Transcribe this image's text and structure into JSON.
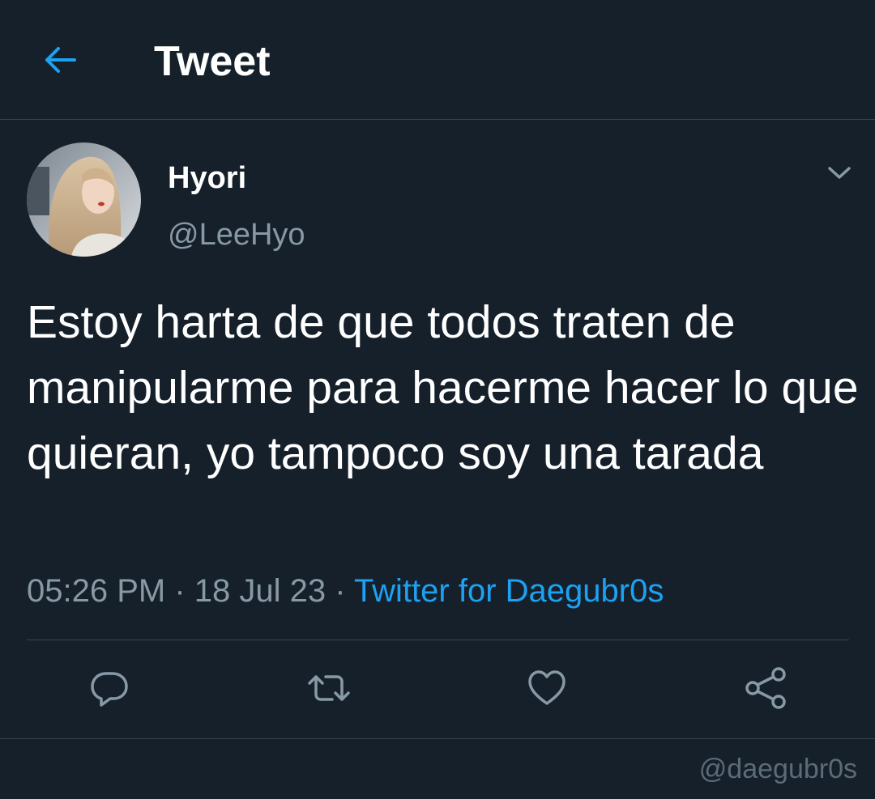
{
  "header": {
    "back_icon": "arrow-left-icon",
    "title": "Tweet"
  },
  "tweet": {
    "author": {
      "display_name": "Hyori",
      "handle": "@LeeHyo",
      "avatar": "profile photo"
    },
    "menu_icon": "chevron-down-icon",
    "text": "Estoy harta de que todos traten de manipularme para hacerme hacer lo que quieran, yo tampoco soy una tarada",
    "time": "05:26 PM",
    "separator": " · ",
    "date": "18 Jul 23",
    "source": "Twitter for Daegubr0s"
  },
  "actions": [
    {
      "name": "reply",
      "icon": "comment-icon"
    },
    {
      "name": "retweet",
      "icon": "retweet-icon"
    },
    {
      "name": "like",
      "icon": "heart-icon"
    },
    {
      "name": "share",
      "icon": "share-icon"
    }
  ],
  "watermark": "@daegubr0s",
  "colors": {
    "background": "#15202b",
    "accent": "#1da1f2",
    "secondary_text": "#8899a6",
    "divider": "#38444d"
  }
}
